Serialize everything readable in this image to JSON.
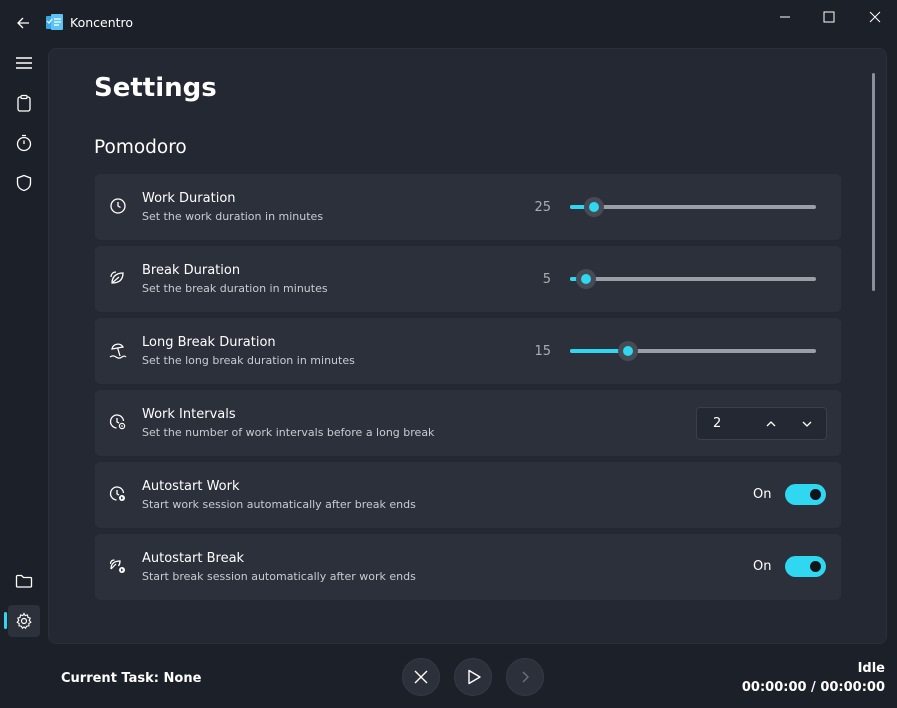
{
  "app": {
    "title": "Koncentro"
  },
  "page": {
    "title": "Settings",
    "section": "Pomodoro"
  },
  "colors": {
    "accent": "#2fd8f0",
    "background": "#1c2028",
    "card": "#2b303b"
  },
  "settings": [
    {
      "title": "Work Duration",
      "description": "Set the work duration in minutes",
      "icon": "clock-icon",
      "control": "slider",
      "value": "25",
      "fraction": 0.1
    },
    {
      "title": "Break Duration",
      "description": "Set the break duration in minutes",
      "icon": "leaves-icon",
      "control": "slider",
      "value": "5",
      "fraction": 0.07
    },
    {
      "title": "Long Break Duration",
      "description": "Set the long break duration in minutes",
      "icon": "beach-umbrella-icon",
      "control": "slider",
      "value": "15",
      "fraction": 0.24
    },
    {
      "title": "Work Intervals",
      "description": "Set the number of work intervals before a long break",
      "icon": "clock-settings-icon",
      "control": "stepper",
      "value": "2"
    },
    {
      "title": "Autostart Work",
      "description": "Start work session automatically after break ends",
      "icon": "clock-play-icon",
      "control": "toggle",
      "value": "On"
    },
    {
      "title": "Autostart Break",
      "description": "Start break session automatically after work ends",
      "icon": "leaves-play-icon",
      "control": "toggle",
      "value": "On"
    }
  ],
  "footer": {
    "current_task": "Current Task: None",
    "status": "Idle",
    "timer": "00:00:00 / 00:00:00"
  }
}
